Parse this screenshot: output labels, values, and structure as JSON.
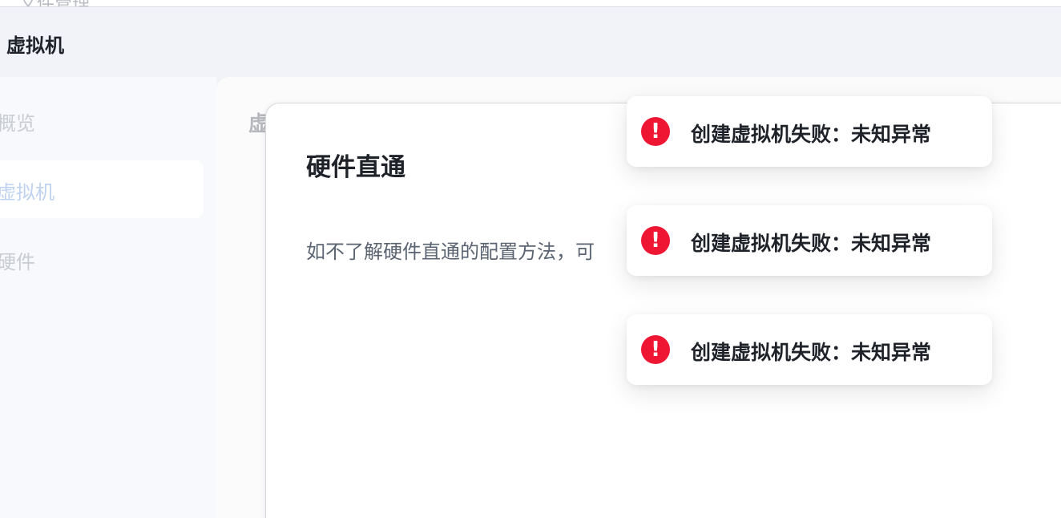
{
  "top_strip": {
    "clipped_text": "文件管理"
  },
  "header": {
    "title": "虚拟机"
  },
  "sidebar": {
    "items": [
      {
        "label": "概览",
        "active": false
      },
      {
        "label": "虚拟机",
        "active": true
      },
      {
        "label": "硬件",
        "active": false
      }
    ]
  },
  "main": {
    "title_clipped": "虚"
  },
  "dialog": {
    "title": "硬件直通",
    "description": "如不了解硬件直通的配置方法，可"
  },
  "toasts": [
    {
      "icon": "error-icon",
      "message": "创建虚拟机失败：未知异常"
    },
    {
      "icon": "error-icon",
      "message": "创建虚拟机失败：未知异常"
    },
    {
      "icon": "error-icon",
      "message": "创建虚拟机失败：未知异常"
    }
  ],
  "colors": {
    "error": "#ef1634",
    "active_nav_text": "#bfd2ef",
    "background": "#f2f3f7"
  }
}
